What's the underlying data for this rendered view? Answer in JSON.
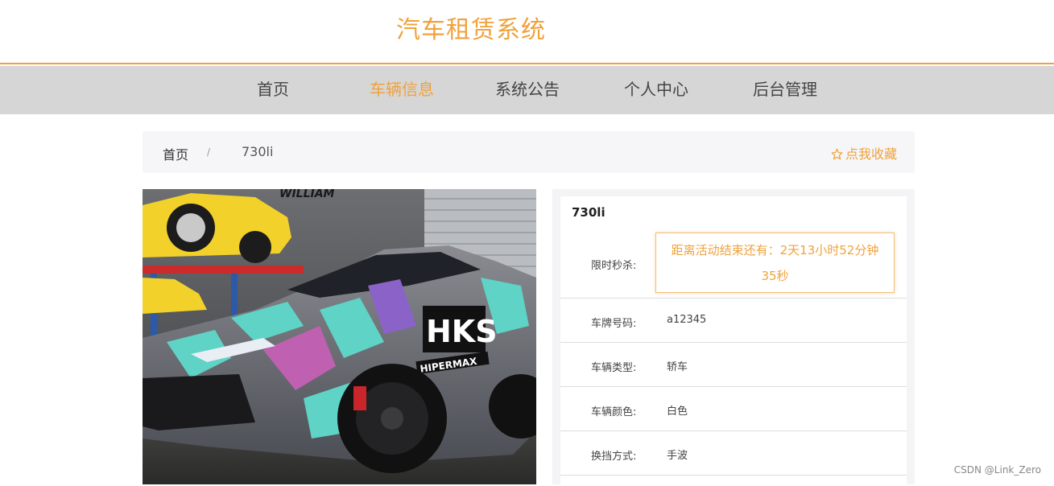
{
  "header": {
    "site_title": "汽车租赁系统"
  },
  "nav": {
    "items": [
      {
        "label": "首页"
      },
      {
        "label": "车辆信息",
        "active": true
      },
      {
        "label": "系统公告"
      },
      {
        "label": "个人中心"
      },
      {
        "label": "后台管理"
      }
    ]
  },
  "breadcrumb": {
    "home": "首页",
    "separator": "/",
    "current": "730li"
  },
  "favorite": {
    "icon": "star-outline-icon",
    "label": "点我收藏"
  },
  "car": {
    "name": "730li",
    "flash_sale_label": "限时秒杀:",
    "countdown_line1": "距离活动结束还有：2天13小时52分钟",
    "countdown_line2": "35秒",
    "fields": [
      {
        "label": "车牌号码:",
        "value": "a12345"
      },
      {
        "label": "车辆类型:",
        "value": "轿车"
      },
      {
        "label": "车辆颜色:",
        "value": "白色"
      },
      {
        "label": "换挡方式:",
        "value": "手波"
      }
    ]
  },
  "photo_decal": {
    "brand": "HKS",
    "sub": "HIPERMAX"
  },
  "watermark": "CSDN @Link_Zero",
  "colors": {
    "accent": "#f0a23c",
    "nav_bg": "#d6d6d6"
  }
}
